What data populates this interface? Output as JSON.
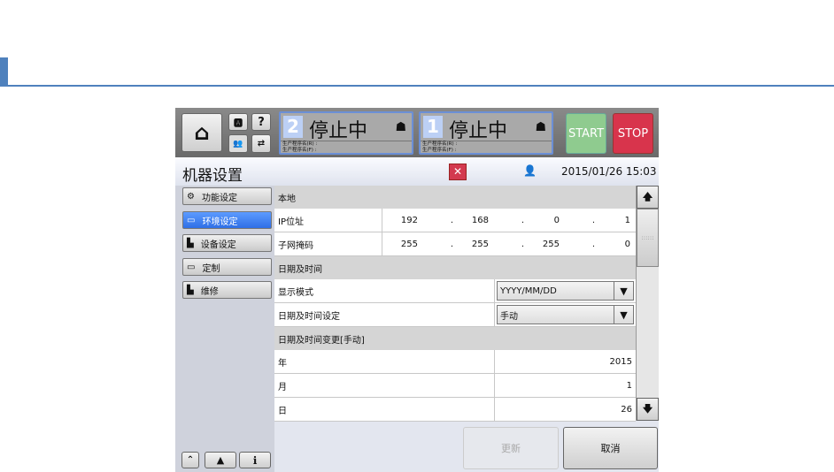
{
  "header": {
    "status": [
      {
        "num": "2",
        "text": "停止中",
        "line1": "生产程序名(R) :",
        "line2": "生产程序名(F) :"
      },
      {
        "num": "1",
        "text": "停止中",
        "line1": "生产程序名(R) :",
        "line2": "生产程序名(F) :"
      }
    ],
    "start": "START",
    "stop": "STOP",
    "help": "?"
  },
  "titlebar": {
    "title": "机器设置",
    "datetime": "2015/01/26 15:03"
  },
  "sidebar": [
    {
      "label": "功能设定"
    },
    {
      "label": "环境设定"
    },
    {
      "label": "设备设定"
    },
    {
      "label": "定制"
    },
    {
      "label": "维修"
    }
  ],
  "content": {
    "sec1": "本地",
    "ip_label": "IP位址",
    "ip": [
      "192",
      "168",
      "0",
      "1"
    ],
    "mask_label": "子网掩码",
    "mask": [
      "255",
      "255",
      "255",
      "0"
    ],
    "sec2": "日期及时间",
    "display_label": "显示模式",
    "display_value": "YYYY/MM/DD",
    "set_label": "日期及时间设定",
    "set_value": "手动",
    "sec3": "日期及时间变更[手动]",
    "year_label": "年",
    "year": "2015",
    "month_label": "月",
    "month": "1",
    "day_label": "日",
    "day": "26"
  },
  "buttons": {
    "update": "更新",
    "cancel": "取消"
  }
}
